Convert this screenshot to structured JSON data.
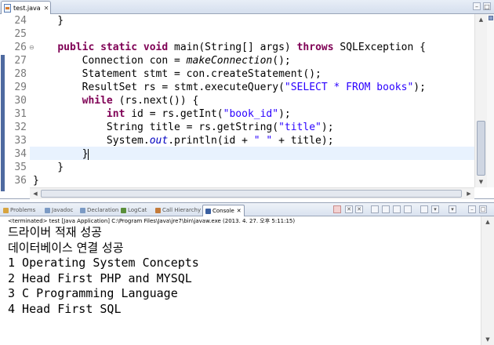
{
  "editor": {
    "tab_label": "test.java",
    "tab_close": "✕",
    "minimize": "–",
    "maximize": "□",
    "active_line": "34",
    "lines": [
      {
        "num": "24",
        "text": "    }"
      },
      {
        "num": "25",
        "text": ""
      },
      {
        "num": "26",
        "text": "    public static void main(String[] args) throws SQLException {"
      },
      {
        "num": "27",
        "text": "        Connection con = makeConnection();"
      },
      {
        "num": "28",
        "text": "        Statement stmt = con.createStatement();"
      },
      {
        "num": "29",
        "text": "        ResultSet rs = stmt.executeQuery(\"SELECT * FROM books\");"
      },
      {
        "num": "30",
        "text": "        while (rs.next()) {"
      },
      {
        "num": "31",
        "text": "            int id = rs.getInt(\"book_id\");"
      },
      {
        "num": "32",
        "text": "            String title = rs.getString(\"title\");"
      },
      {
        "num": "33",
        "text": "            System.out.println(id + \" \" + title);"
      },
      {
        "num": "34",
        "text": "        }"
      },
      {
        "num": "35",
        "text": "    }"
      },
      {
        "num": "36",
        "text": "}"
      }
    ]
  },
  "views": {
    "tabs": [
      {
        "label": "Problems",
        "color": "#d7a440"
      },
      {
        "label": "Javadoc",
        "color": "#7b9ac4"
      },
      {
        "label": "Declaration",
        "color": "#7b9ac4"
      },
      {
        "label": "LogCat",
        "color": "#5a8f3a"
      },
      {
        "label": "Call Hierarchy",
        "color": "#c47b3a"
      },
      {
        "label": "Console",
        "color": "#3a5fa0"
      }
    ],
    "active_tab": "Console",
    "toolbar_close": "✕"
  },
  "console": {
    "status": "<terminated> test [Java Application] C:\\Program Files\\Java\\jre7\\bin\\javaw.exe (2013. 4. 27. 오후 5:11:15)",
    "output": [
      "드라이버 적재 성공",
      "데이터베이스 연결 성공",
      "1 Operating System Concepts",
      "2 Head First PHP and MYSQL",
      "3 C Programming Language",
      "4 Head First SQL"
    ]
  },
  "colors": {
    "keyword": "#7f0055",
    "string": "#2a00ff",
    "field": "#0000c0",
    "current_line": "#e8f2fe"
  },
  "icons": [
    "java-file-icon",
    "close-icon",
    "minimize-icon",
    "maximize-icon",
    "scroll-up-icon",
    "scroll-down-icon",
    "scroll-left-icon",
    "scroll-right-icon"
  ]
}
